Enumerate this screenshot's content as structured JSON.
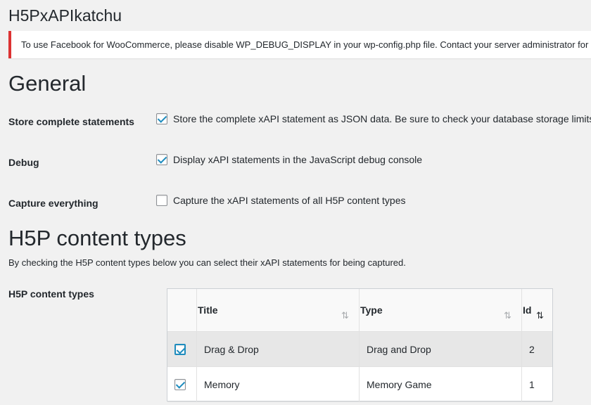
{
  "page_title": "H5PxAPIkatchu",
  "notice": {
    "text": "To use Facebook for WooCommerce, please disable WP_DEBUG_DISPLAY in your wp-config.php file. Contact your server administrator for"
  },
  "general": {
    "heading": "General",
    "settings": [
      {
        "label": "Store complete statements",
        "checked": true,
        "description": "Store the complete xAPI statement as JSON data. Be sure to check your database storage limits."
      },
      {
        "label": "Debug",
        "checked": true,
        "description": "Display xAPI statements in the JavaScript debug console"
      },
      {
        "label": "Capture everything",
        "checked": false,
        "description": "Capture the xAPI statements of all H5P content types"
      }
    ]
  },
  "content_types": {
    "heading": "H5P content types",
    "description": "By checking the H5P content types below you can select their xAPI statements for being captured.",
    "label": "H5P content types",
    "table": {
      "columns": [
        "Title",
        "Type",
        "Id"
      ],
      "sort_icons": {
        "title": "⇅",
        "type": "⇅",
        "id": "⇅"
      },
      "rows": [
        {
          "checked": true,
          "title": "Drag & Drop",
          "type": "Drag and Drop",
          "id": "2",
          "selected": true
        },
        {
          "checked": true,
          "title": "Memory",
          "type": "Memory Game",
          "id": "1",
          "selected": false
        }
      ]
    }
  },
  "colors": {
    "accent": "#1e8cbe",
    "error": "#dc3232",
    "background": "#f1f1f1"
  }
}
